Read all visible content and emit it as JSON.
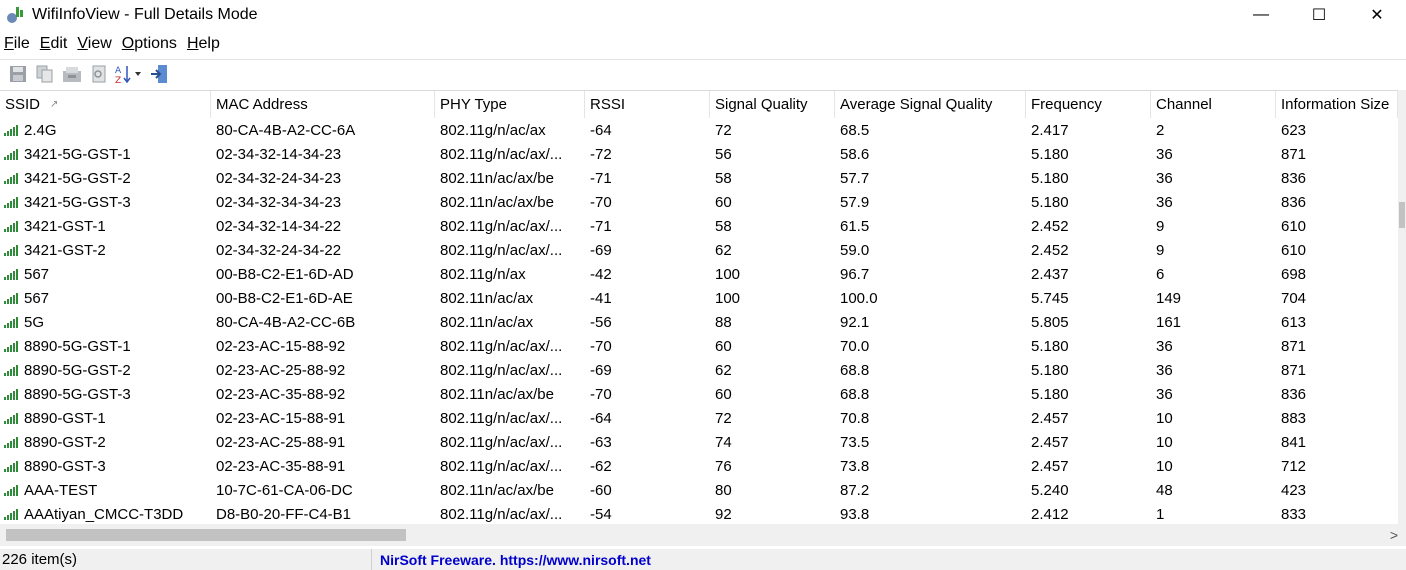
{
  "window": {
    "title": "WifiInfoView  - Full Details Mode",
    "minimize": "—",
    "maximize": "☐",
    "close": "✕"
  },
  "menu": [
    {
      "label": "File",
      "u": "F",
      "rest": "ile"
    },
    {
      "label": "Edit",
      "u": "E",
      "rest": "dit"
    },
    {
      "label": "View",
      "u": "V",
      "rest": "iew"
    },
    {
      "label": "Options",
      "u": "O",
      "rest": "ptions"
    },
    {
      "label": "Help",
      "u": "H",
      "rest": "elp"
    }
  ],
  "toolbar": {
    "icons": [
      "save-icon",
      "copy-icon",
      "properties-icon",
      "find-icon",
      "sort-icon",
      "exit-icon"
    ]
  },
  "columns": [
    "SSID",
    "MAC Address",
    "PHY Type",
    "RSSI",
    "Signal Quality",
    "Average Signal Quality",
    "Frequency",
    "Channel",
    "Information Size"
  ],
  "rows": [
    [
      "2.4G",
      "80-CA-4B-A2-CC-6A",
      "802.11g/n/ac/ax",
      "-64",
      "72",
      "68.5",
      "2.417",
      "2",
      "623"
    ],
    [
      "3421-5G-GST-1",
      "02-34-32-14-34-23",
      "802.11g/n/ac/ax/...",
      "-72",
      "56",
      "58.6",
      "5.180",
      "36",
      "871"
    ],
    [
      "3421-5G-GST-2",
      "02-34-32-24-34-23",
      "802.11n/ac/ax/be",
      "-71",
      "58",
      "57.7",
      "5.180",
      "36",
      "836"
    ],
    [
      "3421-5G-GST-3",
      "02-34-32-34-34-23",
      "802.11n/ac/ax/be",
      "-70",
      "60",
      "57.9",
      "5.180",
      "36",
      "836"
    ],
    [
      "3421-GST-1",
      "02-34-32-14-34-22",
      "802.11g/n/ac/ax/...",
      "-71",
      "58",
      "61.5",
      "2.452",
      "9",
      "610"
    ],
    [
      "3421-GST-2",
      "02-34-32-24-34-22",
      "802.11g/n/ac/ax/...",
      "-69",
      "62",
      "59.0",
      "2.452",
      "9",
      "610"
    ],
    [
      "567",
      "00-B8-C2-E1-6D-AD",
      "802.11g/n/ax",
      "-42",
      "100",
      "96.7",
      "2.437",
      "6",
      "698"
    ],
    [
      "567",
      "00-B8-C2-E1-6D-AE",
      "802.11n/ac/ax",
      "-41",
      "100",
      "100.0",
      "5.745",
      "149",
      "704"
    ],
    [
      "5G",
      "80-CA-4B-A2-CC-6B",
      "802.11n/ac/ax",
      "-56",
      "88",
      "92.1",
      "5.805",
      "161",
      "613"
    ],
    [
      "8890-5G-GST-1",
      "02-23-AC-15-88-92",
      "802.11g/n/ac/ax/...",
      "-70",
      "60",
      "70.0",
      "5.180",
      "36",
      "871"
    ],
    [
      "8890-5G-GST-2",
      "02-23-AC-25-88-92",
      "802.11g/n/ac/ax/...",
      "-69",
      "62",
      "68.8",
      "5.180",
      "36",
      "871"
    ],
    [
      "8890-5G-GST-3",
      "02-23-AC-35-88-92",
      "802.11n/ac/ax/be",
      "-70",
      "60",
      "68.8",
      "5.180",
      "36",
      "836"
    ],
    [
      "8890-GST-1",
      "02-23-AC-15-88-91",
      "802.11g/n/ac/ax/...",
      "-64",
      "72",
      "70.8",
      "2.457",
      "10",
      "883"
    ],
    [
      "8890-GST-2",
      "02-23-AC-25-88-91",
      "802.11g/n/ac/ax/...",
      "-63",
      "74",
      "73.5",
      "2.457",
      "10",
      "841"
    ],
    [
      "8890-GST-3",
      "02-23-AC-35-88-91",
      "802.11g/n/ac/ax/...",
      "-62",
      "76",
      "73.8",
      "2.457",
      "10",
      "712"
    ],
    [
      "AAA-TEST",
      "10-7C-61-CA-06-DC",
      "802.11n/ac/ax/be",
      "-60",
      "80",
      "87.2",
      "5.240",
      "48",
      "423"
    ],
    [
      "AAAtiyan_CMCC-T3DD",
      "D8-B0-20-FF-C4-B1",
      "802.11g/n/ac/ax/...",
      "-54",
      "92",
      "93.8",
      "2.412",
      "1",
      "833"
    ]
  ],
  "status": {
    "count": "226 item(s)",
    "link": "NirSoft Freeware. https://www.nirsoft.net"
  },
  "colors": {
    "signal_green": "#2e8b3a",
    "link_blue": "#0000cc"
  }
}
